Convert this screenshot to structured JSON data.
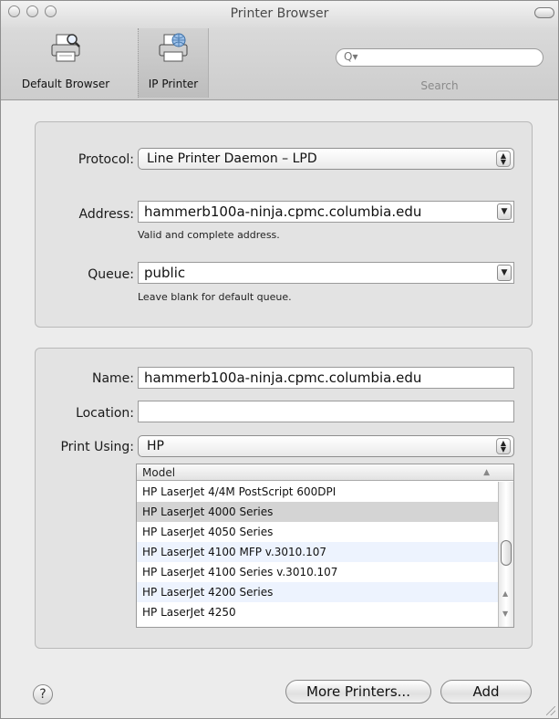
{
  "window": {
    "title": "Printer Browser"
  },
  "toolbar": {
    "items": [
      {
        "label": "Default Browser",
        "icon": "printer-magnifier-icon"
      },
      {
        "label": "IP Printer",
        "icon": "printer-globe-icon"
      }
    ],
    "search": {
      "placeholder": "",
      "label": "Search"
    }
  },
  "connection": {
    "protocol": {
      "label": "Protocol:",
      "value": "Line Printer Daemon – LPD"
    },
    "address": {
      "label": "Address:",
      "value": "hammerb100a-ninja.cpmc.columbia.edu",
      "hint": "Valid and complete address."
    },
    "queue": {
      "label": "Queue:",
      "value": "public",
      "hint": "Leave blank for default queue."
    }
  },
  "details": {
    "name": {
      "label": "Name:",
      "value": "hammerb100a-ninja.cpmc.columbia.edu"
    },
    "location": {
      "label": "Location:",
      "value": ""
    },
    "print_using": {
      "label": "Print Using:",
      "value": "HP"
    }
  },
  "model_list": {
    "header": "Model",
    "rows": [
      "HP LaserJet 4/4M PostScript 600DPI",
      "HP LaserJet 4000 Series",
      "HP LaserJet 4050 Series",
      "HP LaserJet 4100 MFP v.3010.107",
      "HP LaserJet 4100 Series v.3010.107",
      "HP LaserJet 4200 Series",
      "HP LaserJet 4250"
    ],
    "selected_index": 1
  },
  "buttons": {
    "help": "?",
    "more_printers": "More Printers...",
    "add": "Add"
  },
  "colors": {
    "window_bg": "#ececec",
    "selected_row": "#d4d4d4",
    "alt_row": "#edf3fe"
  }
}
